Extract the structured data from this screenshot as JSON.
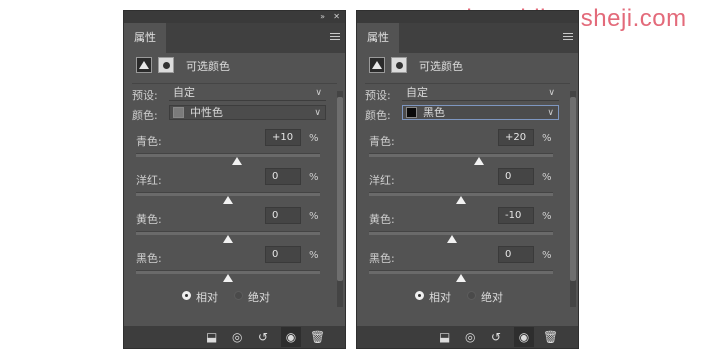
{
  "watermark": "www.haoyidian.sheji.com",
  "panels": [
    {
      "tab": "属性",
      "title": "可选颜色",
      "preset_label": "预设:",
      "preset_value": "自定",
      "color_label": "颜色:",
      "color_value": "中性色",
      "swatch_color": "#7b7b7b",
      "sliders": [
        {
          "label": "青色:",
          "value": "+10",
          "unit": "%",
          "thumb_fraction": 0.55
        },
        {
          "label": "洋红:",
          "value": "0",
          "unit": "%",
          "thumb_fraction": 0.5
        },
        {
          "label": "黄色:",
          "value": "0",
          "unit": "%",
          "thumb_fraction": 0.5
        },
        {
          "label": "黑色:",
          "value": "0",
          "unit": "%",
          "thumb_fraction": 0.5
        }
      ],
      "radio_relative": "相对",
      "radio_absolute": "绝对",
      "relative_selected": true
    },
    {
      "tab": "属性",
      "title": "可选颜色",
      "preset_label": "预设:",
      "preset_value": "自定",
      "color_label": "颜色:",
      "color_value": "黑色",
      "swatch_color": "#0a0a0a",
      "sliders": [
        {
          "label": "青色:",
          "value": "+20",
          "unit": "%",
          "thumb_fraction": 0.6
        },
        {
          "label": "洋红:",
          "value": "0",
          "unit": "%",
          "thumb_fraction": 0.5
        },
        {
          "label": "黄色:",
          "value": "-10",
          "unit": "%",
          "thumb_fraction": 0.45
        },
        {
          "label": "黑色:",
          "value": "0",
          "unit": "%",
          "thumb_fraction": 0.5
        }
      ],
      "radio_relative": "相对",
      "radio_absolute": "绝对",
      "relative_selected": true
    }
  ],
  "icons": {
    "collapse": "double-chevron-icon",
    "close": "close-icon",
    "menu": "panel-menu-icon",
    "clip": "clip-to-layer-icon",
    "view_previous": "view-previous-state-icon",
    "reset": "reset-icon",
    "visibility": "eye-icon",
    "delete": "trash-icon"
  },
  "colors": {
    "panel_bg": "#535353",
    "watermark": "#e36a7a",
    "focus_border": "#7e97c1"
  }
}
